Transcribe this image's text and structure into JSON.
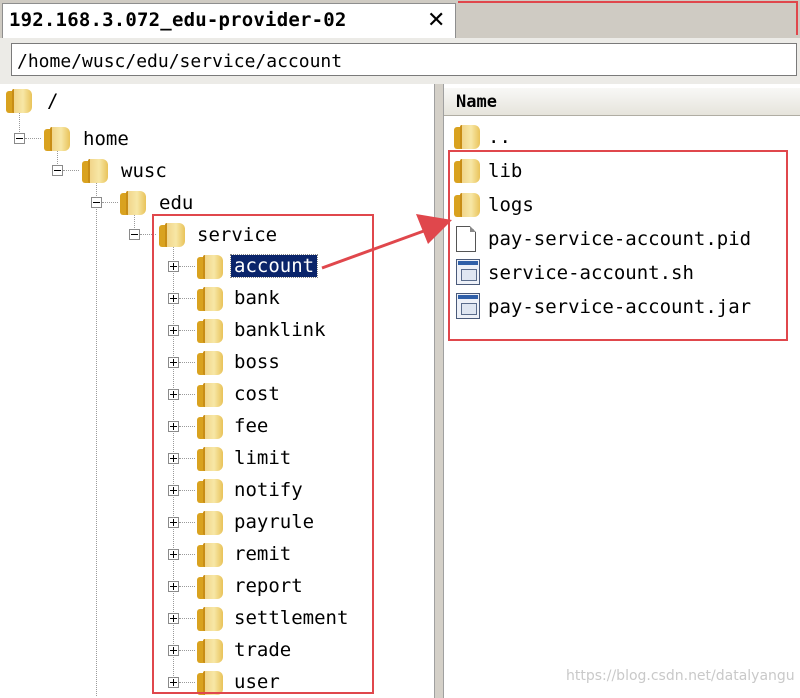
{
  "tab": {
    "title": "192.168.3.072_edu-provider-02",
    "close_glyph": "✕"
  },
  "path_bar": {
    "value": "/home/wusc/edu/service/account"
  },
  "tree": {
    "nodes": [
      {
        "label": "/",
        "state": "expanded"
      },
      {
        "label": "home",
        "state": "expanded"
      },
      {
        "label": "wusc",
        "state": "expanded"
      },
      {
        "label": "edu",
        "state": "expanded"
      },
      {
        "label": "service",
        "state": "expanded"
      },
      {
        "label": "account",
        "state": "collapsed",
        "selected": true
      },
      {
        "label": "bank",
        "state": "collapsed"
      },
      {
        "label": "banklink",
        "state": "collapsed"
      },
      {
        "label": "boss",
        "state": "collapsed"
      },
      {
        "label": "cost",
        "state": "collapsed"
      },
      {
        "label": "fee",
        "state": "collapsed"
      },
      {
        "label": "limit",
        "state": "collapsed"
      },
      {
        "label": "notify",
        "state": "collapsed"
      },
      {
        "label": "payrule",
        "state": "collapsed"
      },
      {
        "label": "remit",
        "state": "collapsed"
      },
      {
        "label": "report",
        "state": "collapsed"
      },
      {
        "label": "settlement",
        "state": "collapsed"
      },
      {
        "label": "trade",
        "state": "collapsed"
      },
      {
        "label": "user",
        "state": "collapsed"
      }
    ]
  },
  "file_list": {
    "column_header": "Name",
    "items": [
      {
        "name": "..",
        "icon": "folder-icon"
      },
      {
        "name": "lib",
        "icon": "folder-icon"
      },
      {
        "name": "logs",
        "icon": "folder-icon"
      },
      {
        "name": "pay-service-account.pid",
        "icon": "file-icon"
      },
      {
        "name": "service-account.sh",
        "icon": "script-icon"
      },
      {
        "name": "pay-service-account.jar",
        "icon": "script-icon"
      }
    ]
  },
  "watermark": "https://blog.csdn.net/datalyangu",
  "colors": {
    "annotation_red": "#e0474c",
    "selection_blue": "#0a246a",
    "folder_yellow": "#f1d58a"
  }
}
